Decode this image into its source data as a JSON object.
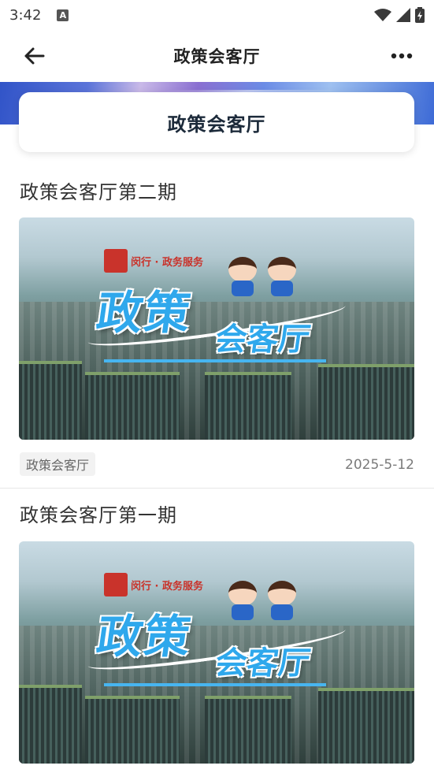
{
  "status_bar": {
    "time": "3:42",
    "icons": [
      "font-a-icon",
      "wifi-icon",
      "signal-icon",
      "battery-charging-icon"
    ]
  },
  "app_bar": {
    "title": "政策会客厅",
    "back_icon": "arrow-left-icon",
    "more_icon": "more-horizontal-icon"
  },
  "hero": {
    "title": "政策会客厅"
  },
  "articles": [
    {
      "title": "政策会客厅第二期",
      "thumbnail": {
        "logo_text": "闵行 · 政务服务",
        "headline": "政策",
        "subheadline": "会客厅"
      },
      "tag": "政策会客厅",
      "date": "2025-5-12"
    },
    {
      "title": "政策会客厅第一期",
      "thumbnail": {
        "logo_text": "闵行 · 政务服务",
        "headline": "政策",
        "subheadline": "会客厅"
      }
    }
  ],
  "colors": {
    "hero_gradient": [
      "#3154c8",
      "#c9b9e8",
      "#9ec0f0"
    ],
    "tag_bg": "#f2f2f2",
    "headline": "#2fa8ec"
  }
}
